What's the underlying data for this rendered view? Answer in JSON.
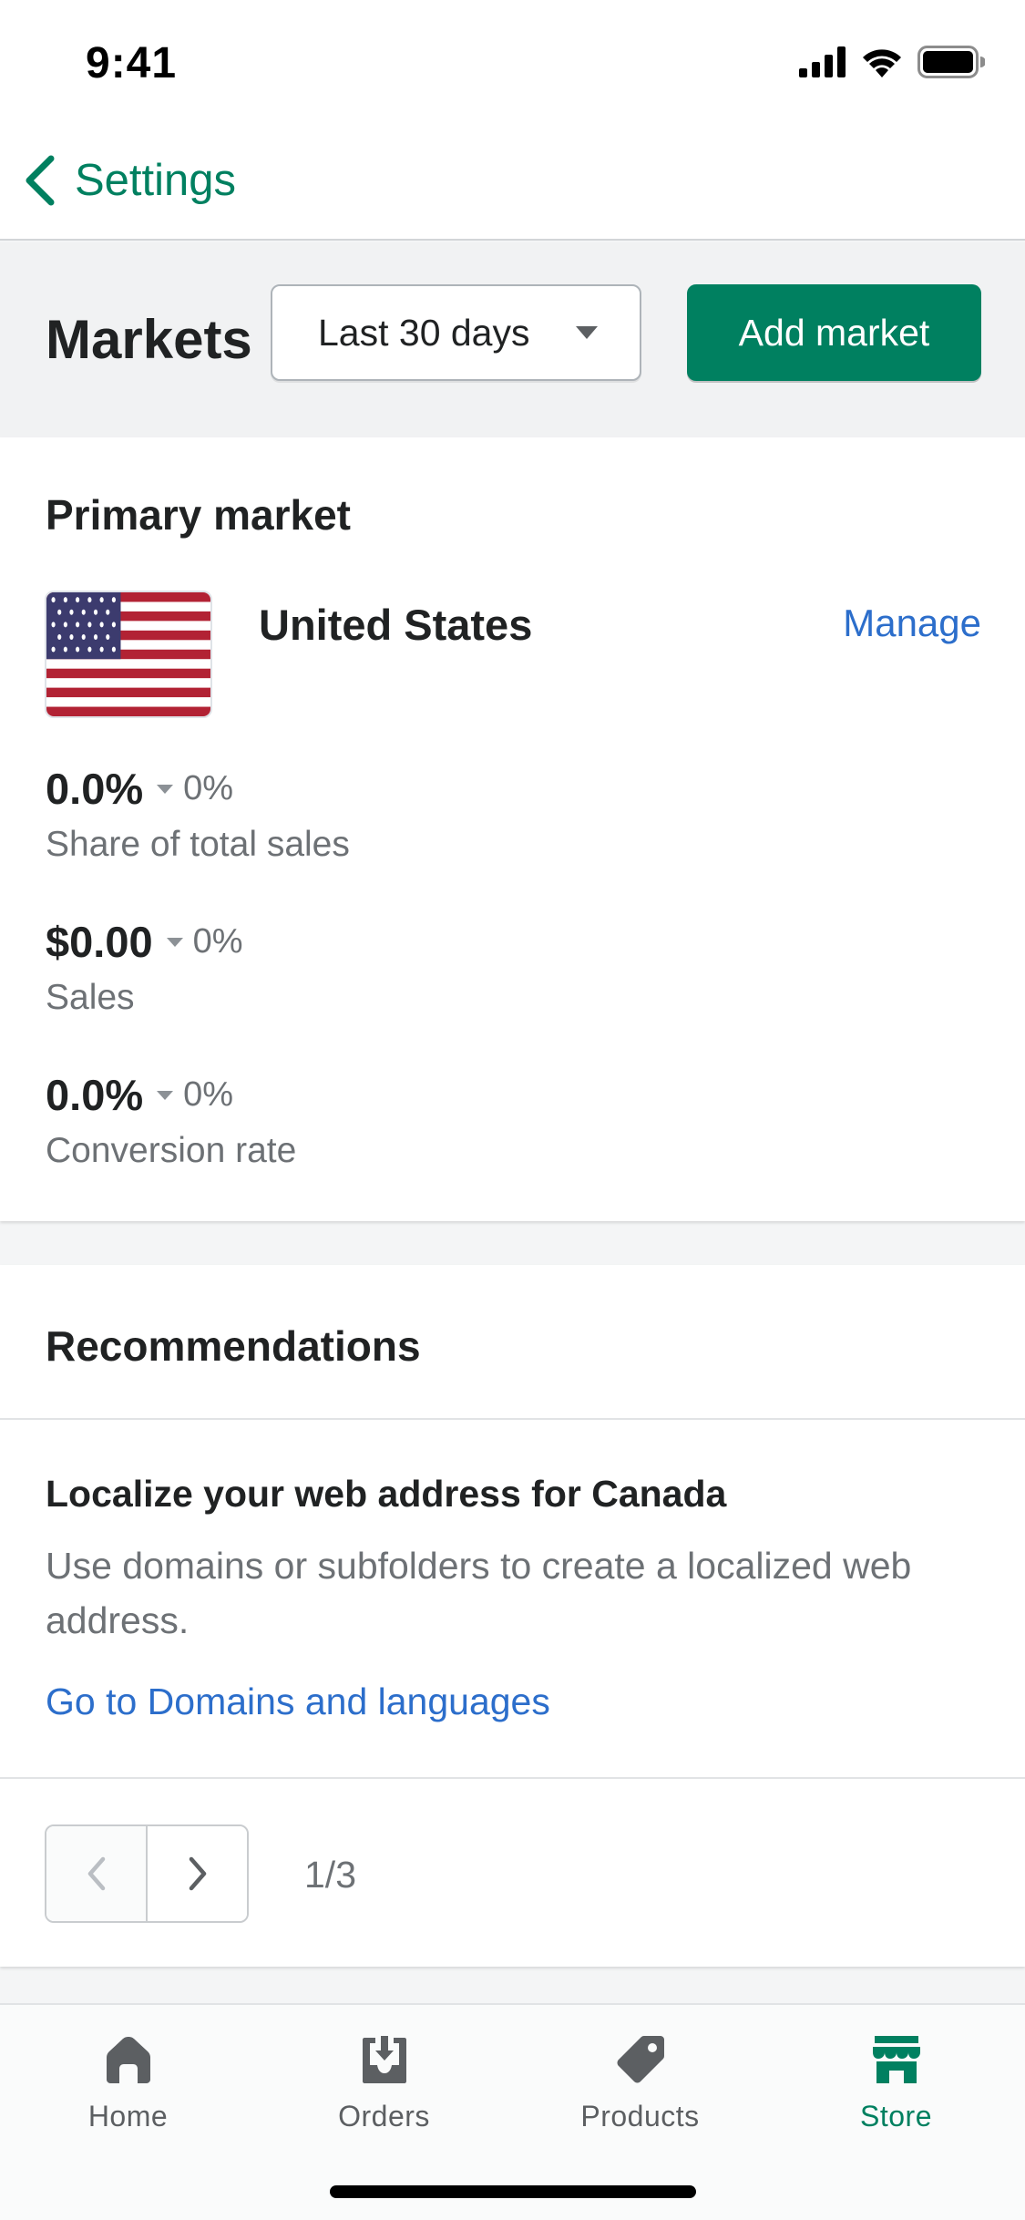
{
  "status_bar": {
    "time": "9:41",
    "icons": [
      "cellular-signal-icon",
      "wifi-icon",
      "battery-icon"
    ]
  },
  "nav": {
    "back_label": "Settings",
    "back_icon": "chevron-left-icon"
  },
  "header": {
    "title": "Markets",
    "date_range": "Last 30 days",
    "add_button_label": "Add market"
  },
  "primary_market": {
    "section_title": "Primary market",
    "country": "United States",
    "flag_icon": "us-flag-icon",
    "manage_label": "Manage",
    "metrics": [
      {
        "value": "0.0%",
        "delta": "0%",
        "label": "Share of total sales"
      },
      {
        "value": "$0.00",
        "delta": "0%",
        "label": "Sales"
      },
      {
        "value": "0.0%",
        "delta": "0%",
        "label": "Conversion rate"
      }
    ]
  },
  "recommendations": {
    "section_title": "Recommendations",
    "item": {
      "title": "Localize your web address for Canada",
      "description": "Use domains or subfolders to create a localized web address.",
      "link": "Go to Domains and languages"
    },
    "page_indicator": "1/3"
  },
  "tab_bar": {
    "tabs": [
      {
        "label": "Home",
        "icon": "home-icon",
        "active": false
      },
      {
        "label": "Orders",
        "icon": "orders-icon",
        "active": false
      },
      {
        "label": "Products",
        "icon": "tag-icon",
        "active": false
      },
      {
        "label": "Store",
        "icon": "store-icon",
        "active": true
      }
    ]
  },
  "colors": {
    "brand_green": "#008060",
    "link_blue": "#2c6ecb",
    "text_primary": "#202223",
    "text_subdued": "#6d7175"
  }
}
